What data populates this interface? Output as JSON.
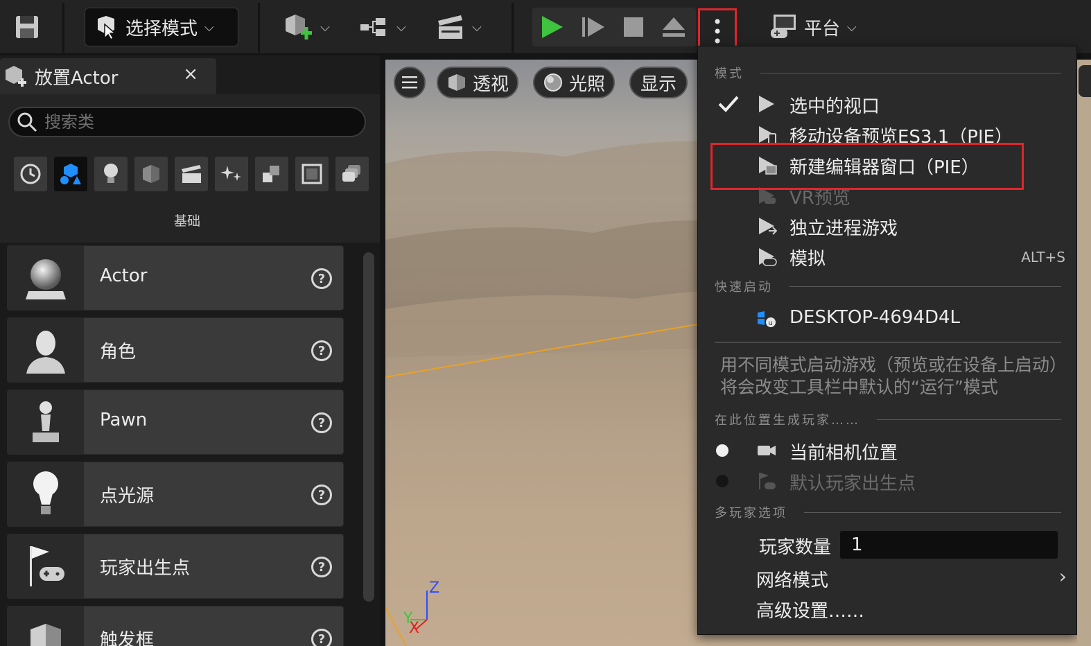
{
  "toolbar": {
    "mode_label": "选择模式",
    "platform_label": "平台"
  },
  "left_panel": {
    "tab_title": "放置Actor",
    "close_glyph": "×",
    "search_placeholder": "搜索类",
    "category_label": "基础",
    "items": [
      {
        "name": "Actor"
      },
      {
        "name": "角色"
      },
      {
        "name": "Pawn"
      },
      {
        "name": "点光源"
      },
      {
        "name": "玩家出生点"
      },
      {
        "name": "触发框"
      }
    ]
  },
  "viewport": {
    "perspective_label": "透视",
    "lighting_label": "光照",
    "show_label": "显示",
    "axis_z": "Z",
    "axis_y": "Y",
    "axis_x": "X"
  },
  "menu": {
    "section_mode": "模式",
    "items_mode": [
      {
        "label": "选中的视口",
        "checked": true
      },
      {
        "label": "移动设备预览ES3.1（PIE）"
      },
      {
        "label": "新建编辑器窗口（PIE）"
      },
      {
        "label": "VR预览",
        "disabled": true
      },
      {
        "label": "独立进程游戏"
      },
      {
        "label": "模拟",
        "shortcut": "ALT+S"
      }
    ],
    "section_quick": "快速启动",
    "device": "DESKTOP-4694D4L",
    "description": "用不同模式启动游戏（预览或在设备上启动）将会改变工具栏中默认的“运行”模式",
    "section_spawn": "在此位置生成玩家……",
    "spawn_current": "当前相机位置",
    "spawn_default": "默认玩家出生点",
    "section_multi": "多玩家选项",
    "players_label": "玩家数量",
    "players_value": "1",
    "net_mode": "网络模式",
    "advanced": "高级设置……"
  },
  "colors": {
    "highlight": "#e0262b",
    "play_green": "#3fc43f",
    "accent_blue": "#1f8fff"
  }
}
